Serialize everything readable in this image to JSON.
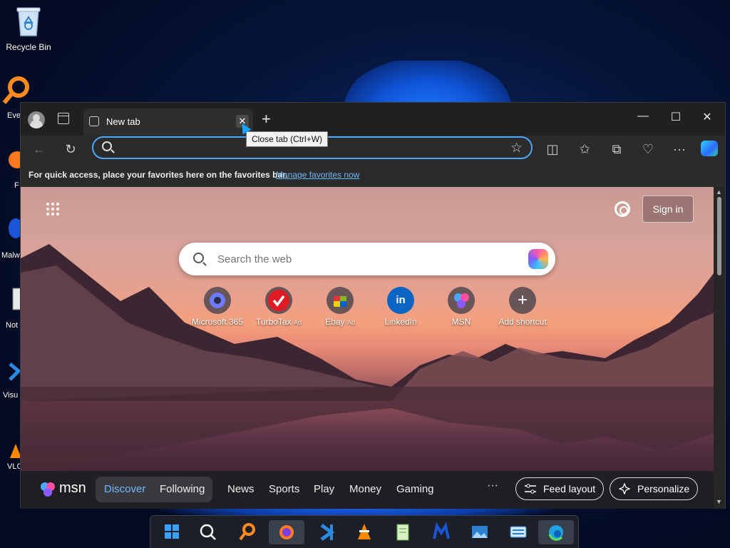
{
  "desktop": {
    "recycle_bin_label": "Recycle Bin",
    "edge_labels": [
      "Eve",
      "F",
      "Malw",
      "Not",
      "Visu",
      "VLC"
    ]
  },
  "browser": {
    "tab_title": "New tab",
    "tooltip": "Close tab (Ctrl+W)",
    "address_placeholder": "",
    "favorites_message": "For quick access, place your favorites here on the favorites bar.",
    "favorites_link": "Manage favorites now"
  },
  "newtab": {
    "sign_in_label": "Sign in",
    "search_placeholder": "Search the web",
    "shortcuts": [
      {
        "label": "Microsoft 365",
        "ad": "",
        "icon": "microsoft-365-icon"
      },
      {
        "label": "TurboTax",
        "ad": "Ad",
        "icon": "turbotax-icon"
      },
      {
        "label": "Ebay",
        "ad": "Ad",
        "icon": "ebay-icon"
      },
      {
        "label": "LinkedIn",
        "ad": "",
        "icon": "linkedin-icon"
      },
      {
        "label": "MSN",
        "ad": "",
        "icon": "msn-icon"
      },
      {
        "label": "Add shortcut",
        "ad": "",
        "icon": "plus-icon"
      }
    ]
  },
  "feedbar": {
    "brand": "msn",
    "discover": "Discover",
    "following": "Following",
    "nav": [
      "News",
      "Sports",
      "Play",
      "Money",
      "Gaming"
    ],
    "more": "···",
    "feed_layout": "Feed layout",
    "personalize": "Personalize"
  },
  "colors": {
    "accent": "#4aa8ff",
    "discover_active": "#6fb6ff",
    "window_bg": "#202020"
  },
  "taskbar": {
    "items": [
      "windows-start-icon",
      "search-icon",
      "everything-search-icon",
      "firefox-icon",
      "vscode-icon",
      "vlc-icon",
      "notepadplusplus-icon",
      "malwarebytes-icon",
      "photos-icon",
      "keyboard-app-icon",
      "edge-icon"
    ]
  }
}
